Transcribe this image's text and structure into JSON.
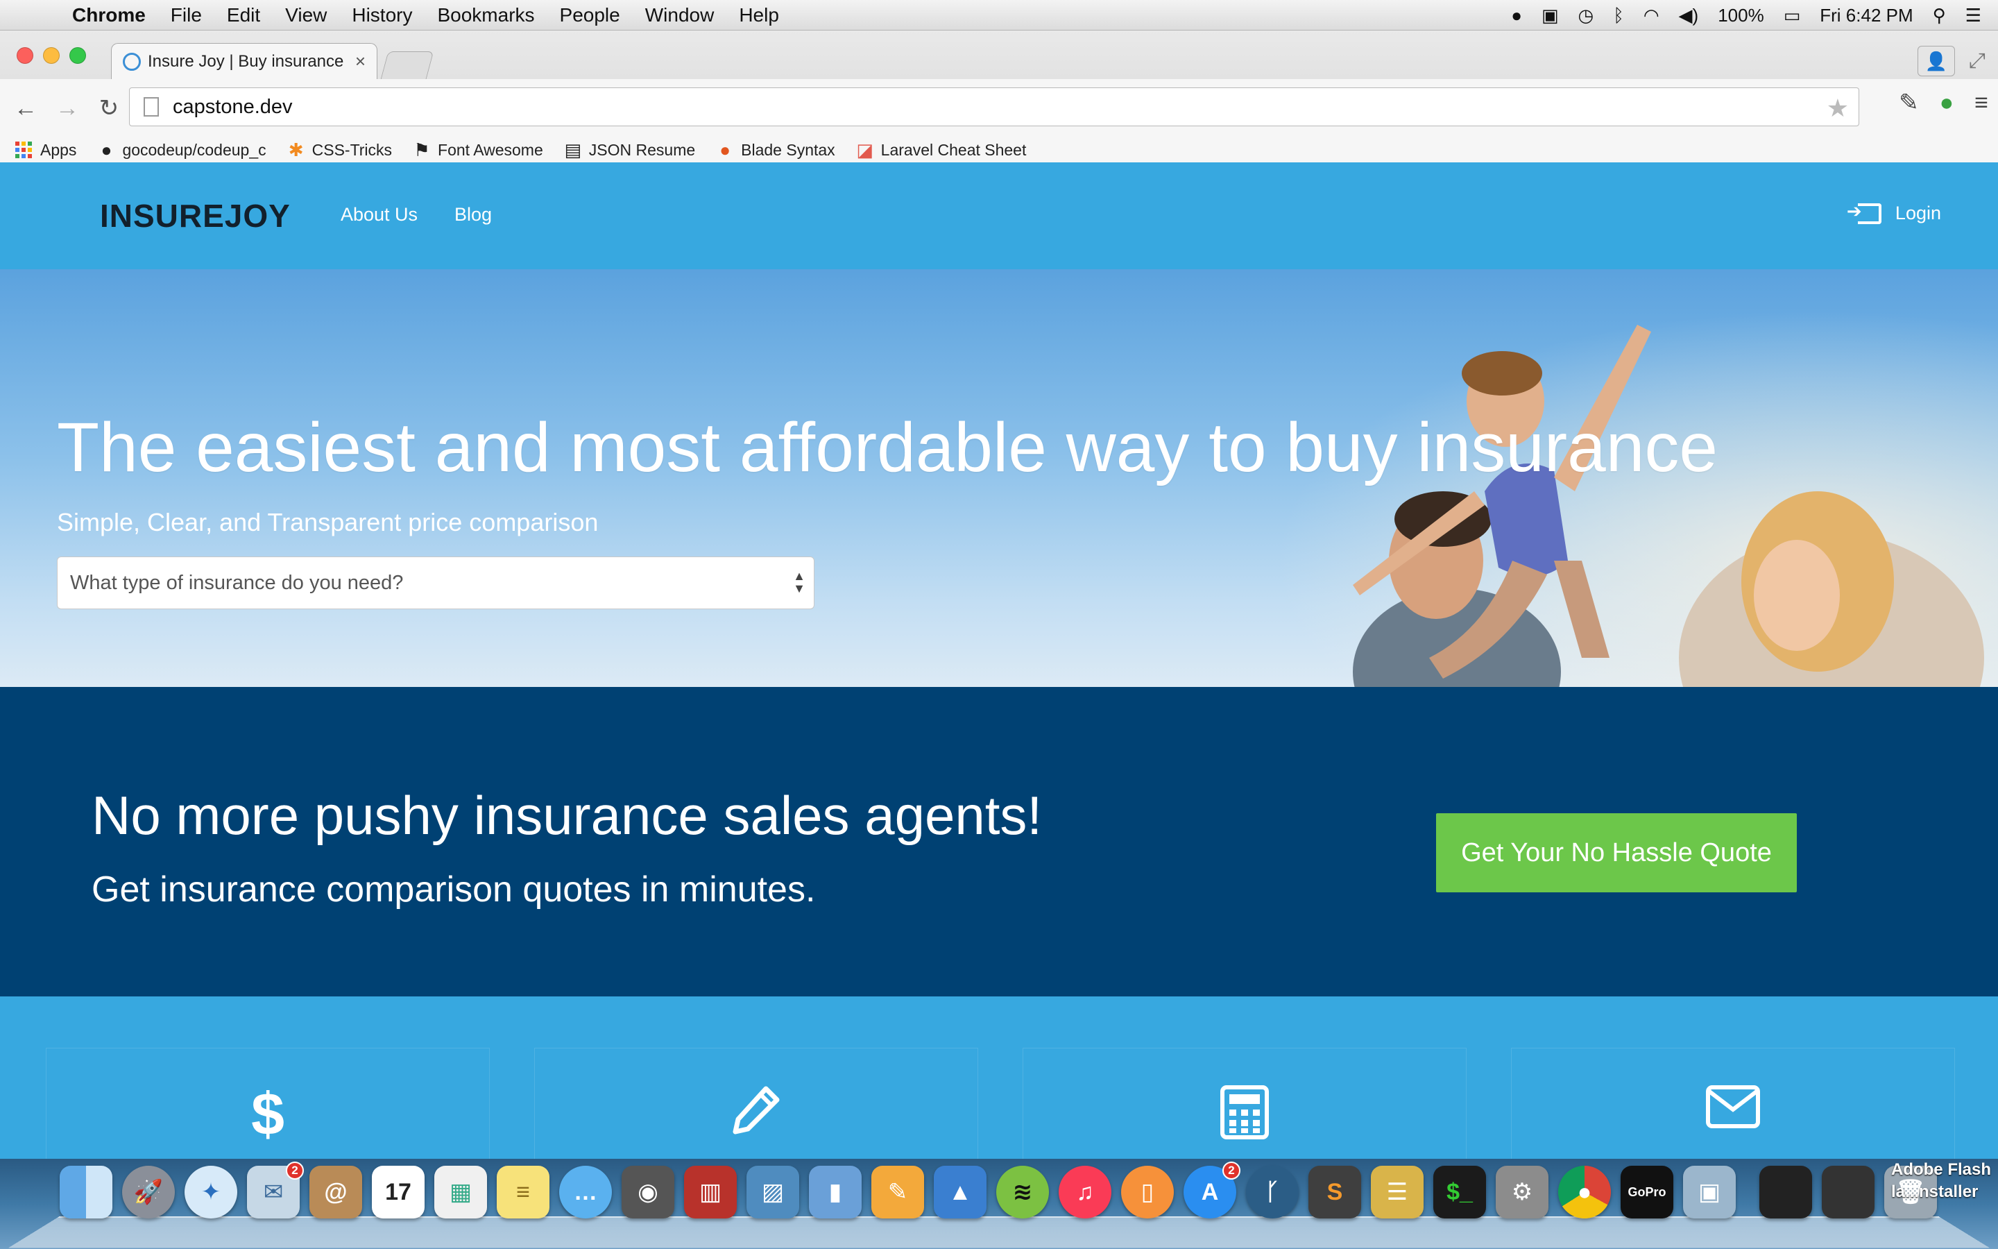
{
  "menubar": {
    "app": "Chrome",
    "items": [
      "File",
      "Edit",
      "View",
      "History",
      "Bookmarks",
      "People",
      "Window",
      "Help"
    ],
    "battery": "100%",
    "clock": "Fri 6:42 PM"
  },
  "browser": {
    "tab_title": "Insure Joy | Buy insurance",
    "url": "capstone.dev",
    "bookmarks": [
      {
        "label": "Apps",
        "icon": "apps-grid-icon"
      },
      {
        "label": "gocodeup/codeup_c",
        "icon": "github-icon"
      },
      {
        "label": "CSS-Tricks",
        "icon": "asterisk-icon"
      },
      {
        "label": "Font Awesome",
        "icon": "flag-icon"
      },
      {
        "label": "JSON Resume",
        "icon": "document-icon"
      },
      {
        "label": "Blade Syntax",
        "icon": "monkey-icon"
      },
      {
        "label": "Laravel Cheat Sheet",
        "icon": "laravel-icon"
      }
    ]
  },
  "site": {
    "logo": "INSUREJOY",
    "nav": {
      "about": "About Us",
      "blog": "Blog",
      "login": "Login"
    },
    "hero": {
      "title": "The easiest and most affordable way to buy insurance",
      "subtitle": "Simple, Clear, and Transparent price comparison",
      "select_placeholder": "What type of insurance do you need?"
    },
    "cta": {
      "title": "No more pushy insurance sales agents!",
      "subtitle": "Get insurance comparison quotes in minutes.",
      "button": "Get Your No Hassle Quote"
    },
    "features": [
      {
        "icon": "dollar-icon"
      },
      {
        "icon": "pencil-icon"
      },
      {
        "icon": "calculator-icon"
      },
      {
        "icon": "envelope-icon"
      }
    ],
    "colors": {
      "nav_bg": "#37a8e0",
      "cta_bg": "#004173",
      "cta_button": "#6cc74a"
    }
  },
  "dock": {
    "badges": {
      "mail": "2",
      "app_store": "2"
    },
    "flash_label_1": "Adobe Flash",
    "flash_label_2": "la...nstaller"
  }
}
